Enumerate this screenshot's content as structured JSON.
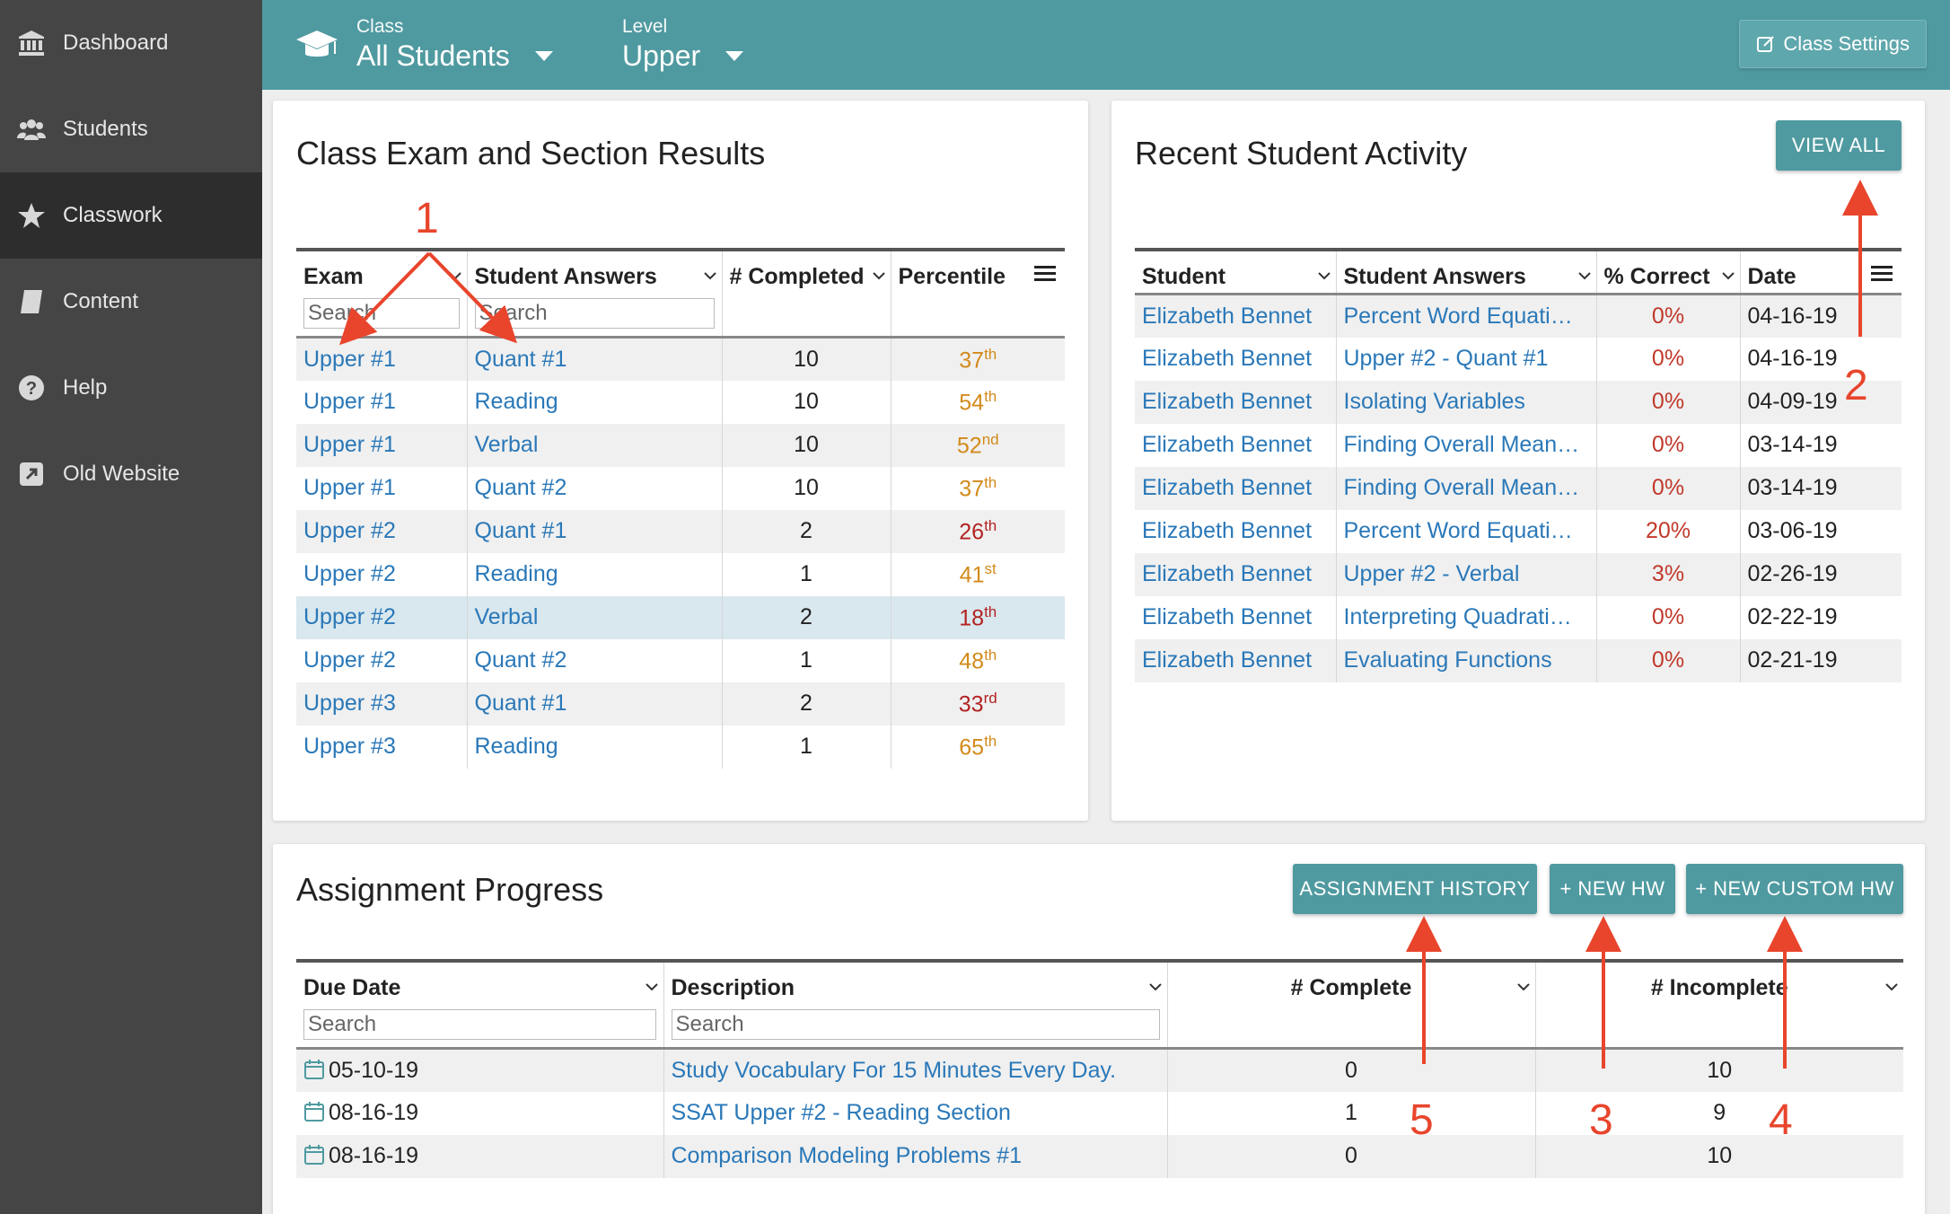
{
  "sidebar": {
    "items": [
      {
        "label": "Dashboard",
        "icon": "bank-icon"
      },
      {
        "label": "Students",
        "icon": "users-icon"
      },
      {
        "label": "Classwork",
        "icon": "star-icon"
      },
      {
        "label": "Content",
        "icon": "book-icon"
      },
      {
        "label": "Help",
        "icon": "question-icon"
      },
      {
        "label": "Old Website",
        "icon": "external-link-icon"
      }
    ],
    "active": "Classwork"
  },
  "topbar": {
    "class_label": "Class",
    "class_value": "All Students",
    "level_label": "Level",
    "level_value": "Upper",
    "settings_label": "Class Settings"
  },
  "exam_results": {
    "title": "Class Exam and Section Results",
    "columns": [
      "Exam",
      "Student Answers",
      "# Completed",
      "Percentile"
    ],
    "search_placeholder": "Search",
    "rows": [
      {
        "exam": "Upper #1",
        "section": "Quant #1",
        "completed": "10",
        "pct": "37",
        "suffix": "th"
      },
      {
        "exam": "Upper #1",
        "section": "Reading",
        "completed": "10",
        "pct": "54",
        "suffix": "th"
      },
      {
        "exam": "Upper #1",
        "section": "Verbal",
        "completed": "10",
        "pct": "52",
        "suffix": "nd"
      },
      {
        "exam": "Upper #1",
        "section": "Quant #2",
        "completed": "10",
        "pct": "37",
        "suffix": "th"
      },
      {
        "exam": "Upper #2",
        "section": "Quant #1",
        "completed": "2",
        "pct": "26",
        "suffix": "th"
      },
      {
        "exam": "Upper #2",
        "section": "Reading",
        "completed": "1",
        "pct": "41",
        "suffix": "st"
      },
      {
        "exam": "Upper #2",
        "section": "Verbal",
        "completed": "2",
        "pct": "18",
        "suffix": "th"
      },
      {
        "exam": "Upper #2",
        "section": "Quant #2",
        "completed": "1",
        "pct": "48",
        "suffix": "th"
      },
      {
        "exam": "Upper #3",
        "section": "Quant #1",
        "completed": "2",
        "pct": "33",
        "suffix": "rd"
      },
      {
        "exam": "Upper #3",
        "section": "Reading",
        "completed": "1",
        "pct": "65",
        "suffix": "th"
      }
    ]
  },
  "activity": {
    "title": "Recent Student Activity",
    "view_all": "VIEW ALL",
    "columns": [
      "Student",
      "Student Answers",
      "% Correct",
      "Date"
    ],
    "rows": [
      {
        "student": "Elizabeth Bennet",
        "answers": "Percent Word Equati…",
        "correct": "0%",
        "date": "04-16-19"
      },
      {
        "student": "Elizabeth Bennet",
        "answers": "Upper #2 - Quant #1",
        "correct": "0%",
        "date": "04-16-19"
      },
      {
        "student": "Elizabeth Bennet",
        "answers": "Isolating Variables",
        "correct": "0%",
        "date": "04-09-19"
      },
      {
        "student": "Elizabeth Bennet",
        "answers": "Finding Overall Mean…",
        "correct": "0%",
        "date": "03-14-19"
      },
      {
        "student": "Elizabeth Bennet",
        "answers": "Finding Overall Mean…",
        "correct": "0%",
        "date": "03-14-19"
      },
      {
        "student": "Elizabeth Bennet",
        "answers": "Percent Word Equati…",
        "correct": "20%",
        "date": "03-06-19"
      },
      {
        "student": "Elizabeth Bennet",
        "answers": "Upper #2 - Verbal",
        "correct": "3%",
        "date": "02-26-19"
      },
      {
        "student": "Elizabeth Bennet",
        "answers": "Interpreting Quadrati…",
        "correct": "0%",
        "date": "02-22-19"
      },
      {
        "student": "Elizabeth Bennet",
        "answers": "Evaluating Functions",
        "correct": "0%",
        "date": "02-21-19"
      }
    ]
  },
  "assignments": {
    "title": "Assignment Progress",
    "buttons": {
      "history": "ASSIGNMENT HISTORY",
      "new_hw": "+ NEW HW",
      "new_custom": "+ NEW CUSTOM HW"
    },
    "columns": [
      "Due Date",
      "Description",
      "# Complete",
      "# Incomplete"
    ],
    "search_placeholder": "Search",
    "rows": [
      {
        "due": "05-10-19",
        "desc": "Study Vocabulary For 15 Minutes Every Day.",
        "complete": "0",
        "incomplete": "10"
      },
      {
        "due": "08-16-19",
        "desc": "SSAT Upper #2 - Reading Section",
        "complete": "1",
        "incomplete": "9"
      },
      {
        "due": "08-16-19",
        "desc": "Comparison Modeling Problems #1",
        "complete": "0",
        "incomplete": "10"
      }
    ]
  },
  "annotations": [
    "1",
    "2",
    "3",
    "4",
    "5"
  ],
  "colors": {
    "accent": "#4f9aa0",
    "sidebar": "#454545",
    "link": "#2a78b8",
    "annotation": "#e8452c"
  }
}
